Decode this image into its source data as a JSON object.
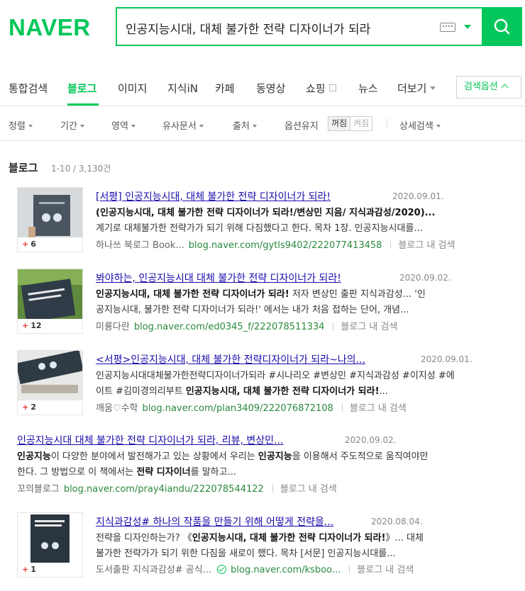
{
  "header": {
    "logo": "NAVER",
    "query": "인공지능시대, 대체 불가한 전략 디자이너가 되라",
    "brand_color": "#03c75a"
  },
  "tabs": [
    {
      "label": "통합검색"
    },
    {
      "label": "블로그"
    },
    {
      "label": "이미지"
    },
    {
      "label": "지식iN"
    },
    {
      "label": "카페"
    },
    {
      "label": "동영상"
    },
    {
      "label": "쇼핑"
    },
    {
      "label": "뉴스"
    },
    {
      "label": "더보기"
    }
  ],
  "search_options_label": "검색옵션",
  "filters": {
    "sort": "정렬",
    "period": "기간",
    "area": "영역",
    "similar_docs": "유사문서",
    "source": "출처",
    "keep_options": "옵션유지",
    "off": "꺼짐",
    "on": "켜짐",
    "detailed": "상세검색"
  },
  "section": {
    "title": "블로그",
    "count": "1-10 / 3,130건"
  },
  "results": [
    {
      "title": "[서평] 인공지능시대, 대체 불가한 전략 디자이너가 되라!",
      "date": "2020.09.01.",
      "desc1": "(인공지능시대, 대체 불가한 전략 디자이너가 되라!/변상민 지음/ 지식과감성/2020)...",
      "desc2": "계기로 대체불가한 전략가가 되기 위해 다짐했다고 한다. 목차 1장. 인공지능시대를...",
      "source": "하나쓰 북로그 Book...",
      "url": "blog.naver.com/gytls9402/222077413458",
      "in_blog": "블로그 내 검색",
      "thumb_count": "6"
    },
    {
      "title": "봐야하는, 인공지능시대 대체 불가한 전략 디자이너가 되라!",
      "date": "2020.09.02.",
      "desc1_bold": "인공지능시대, 대체 불가한 전략 디자이너가 되라!",
      "desc1_rest": " 저자 변상민 출판 지식과감성... '인",
      "desc2": "공지능시대, 불가한 전략 디자이너가 되라!' 에서는 내가 처음 접하는 단어, 개념...",
      "source": "미룡다란",
      "url": "blog.naver.com/ed0345_f/222078511334",
      "in_blog": "블로그 내 검색",
      "thumb_count": "12"
    },
    {
      "title": "<서평>인공지능시대, 대체 불가한 전략디자이너가 되라~나의...",
      "date": "2020.09.01.",
      "desc1": "인공지능시대대체불가한전략디자이너가되라 #시나리오 #변상민 #지식과감성 #이지성 #에",
      "desc2_rest": "이트 #김미경의리부트 ",
      "desc2_bold": "인공지능시대, 대체 불가한 전략 디자이너가 되라!",
      "desc2_tail": "...",
      "source": "깨움♡수학",
      "url": "blog.naver.com/plan3409/222076872108",
      "in_blog": "블로그 내 검색",
      "thumb_count": "2"
    },
    {
      "title": "인공지능시대 대체 불가한 전략 디자이너가 되라, 리뷰, 변상민...",
      "date": "2020.09.02.",
      "desc1_bold1": "인공지능",
      "desc1_mid": "이 다양한 분야에서 발전해가고 있는 상황에서 우리는 ",
      "desc1_bold2": "인공지능",
      "desc1_tail": "을 이용해서 주도적으로 움직여야만",
      "desc2_rest": "한다. 그 방법으로 이 책에서는 ",
      "desc2_bold": "전략 디자이너",
      "desc2_tail": "를 말하고...",
      "source": "꼬의블로그",
      "url": "blog.naver.com/pray4iandu/222078544122",
      "in_blog": "블로그 내 검색"
    },
    {
      "title": "지식과감성# 하나의 작품을 만들기 위해 어떻게 전략을...",
      "date": "2020.08.04.",
      "desc1_rest": "전략을 디자인하는가? 《",
      "desc1_bold": "인공지능시대, 대체 불가한 전략 디자이너가 되라!",
      "desc1_tail": "》... 대체",
      "desc2": "불가한 전략가가 되기 위한 다짐을 새로이 했다. 목차 [서문] 인공지능시대를...",
      "source": "도서출판 지식과감성# 공식...",
      "url": "blog.naver.com/ksboo...",
      "in_blog": "블로그 내 검색",
      "thumb_count": "1"
    }
  ]
}
